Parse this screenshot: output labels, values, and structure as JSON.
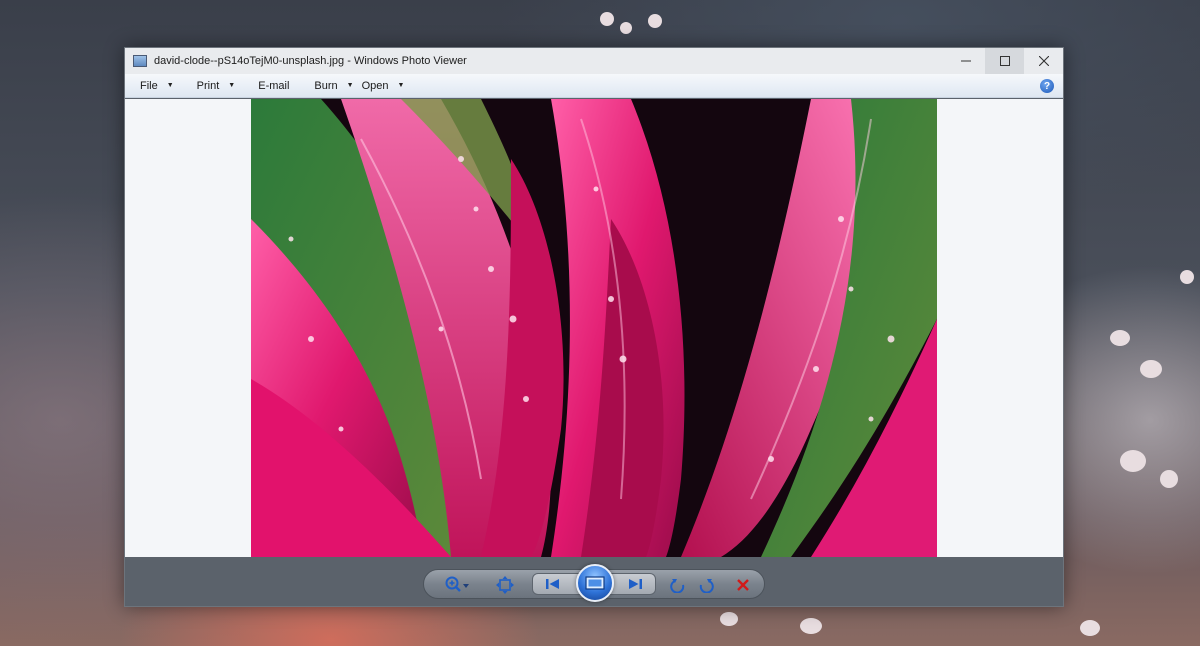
{
  "window": {
    "title": "david-clode--pS14oTejM0-unsplash.jpg - Windows Photo Viewer",
    "controls": {
      "minimize_icon": "minimize-icon",
      "maximize_icon": "maximize-icon",
      "close_icon": "close-icon"
    }
  },
  "menu": {
    "items": [
      {
        "label": "File",
        "has_dropdown": true
      },
      {
        "label": "Print",
        "has_dropdown": true
      },
      {
        "label": "E-mail",
        "has_dropdown": false
      },
      {
        "label": "Burn",
        "has_dropdown": true
      },
      {
        "label": "Open",
        "has_dropdown": true
      }
    ],
    "help_icon": "help-icon"
  },
  "viewer": {
    "image_subject": "pink and green leaves with water droplets"
  },
  "toolbar": {
    "buttons": [
      {
        "name": "zoom-button",
        "icon": "magnifier-icon"
      },
      {
        "name": "actual-size-button",
        "icon": "fit-window-icon"
      },
      {
        "name": "previous-button",
        "icon": "previous-icon"
      },
      {
        "name": "slideshow-button",
        "icon": "slideshow-icon"
      },
      {
        "name": "next-button",
        "icon": "next-icon"
      },
      {
        "name": "rotate-counterclockwise-button",
        "icon": "rotate-left-icon"
      },
      {
        "name": "rotate-clockwise-button",
        "icon": "rotate-right-icon"
      },
      {
        "name": "delete-button",
        "icon": "delete-icon"
      }
    ]
  },
  "colors": {
    "accent_blue": "#2f73d8",
    "delete_red": "#d11a1a",
    "chrome_gray": "#5b626b"
  }
}
